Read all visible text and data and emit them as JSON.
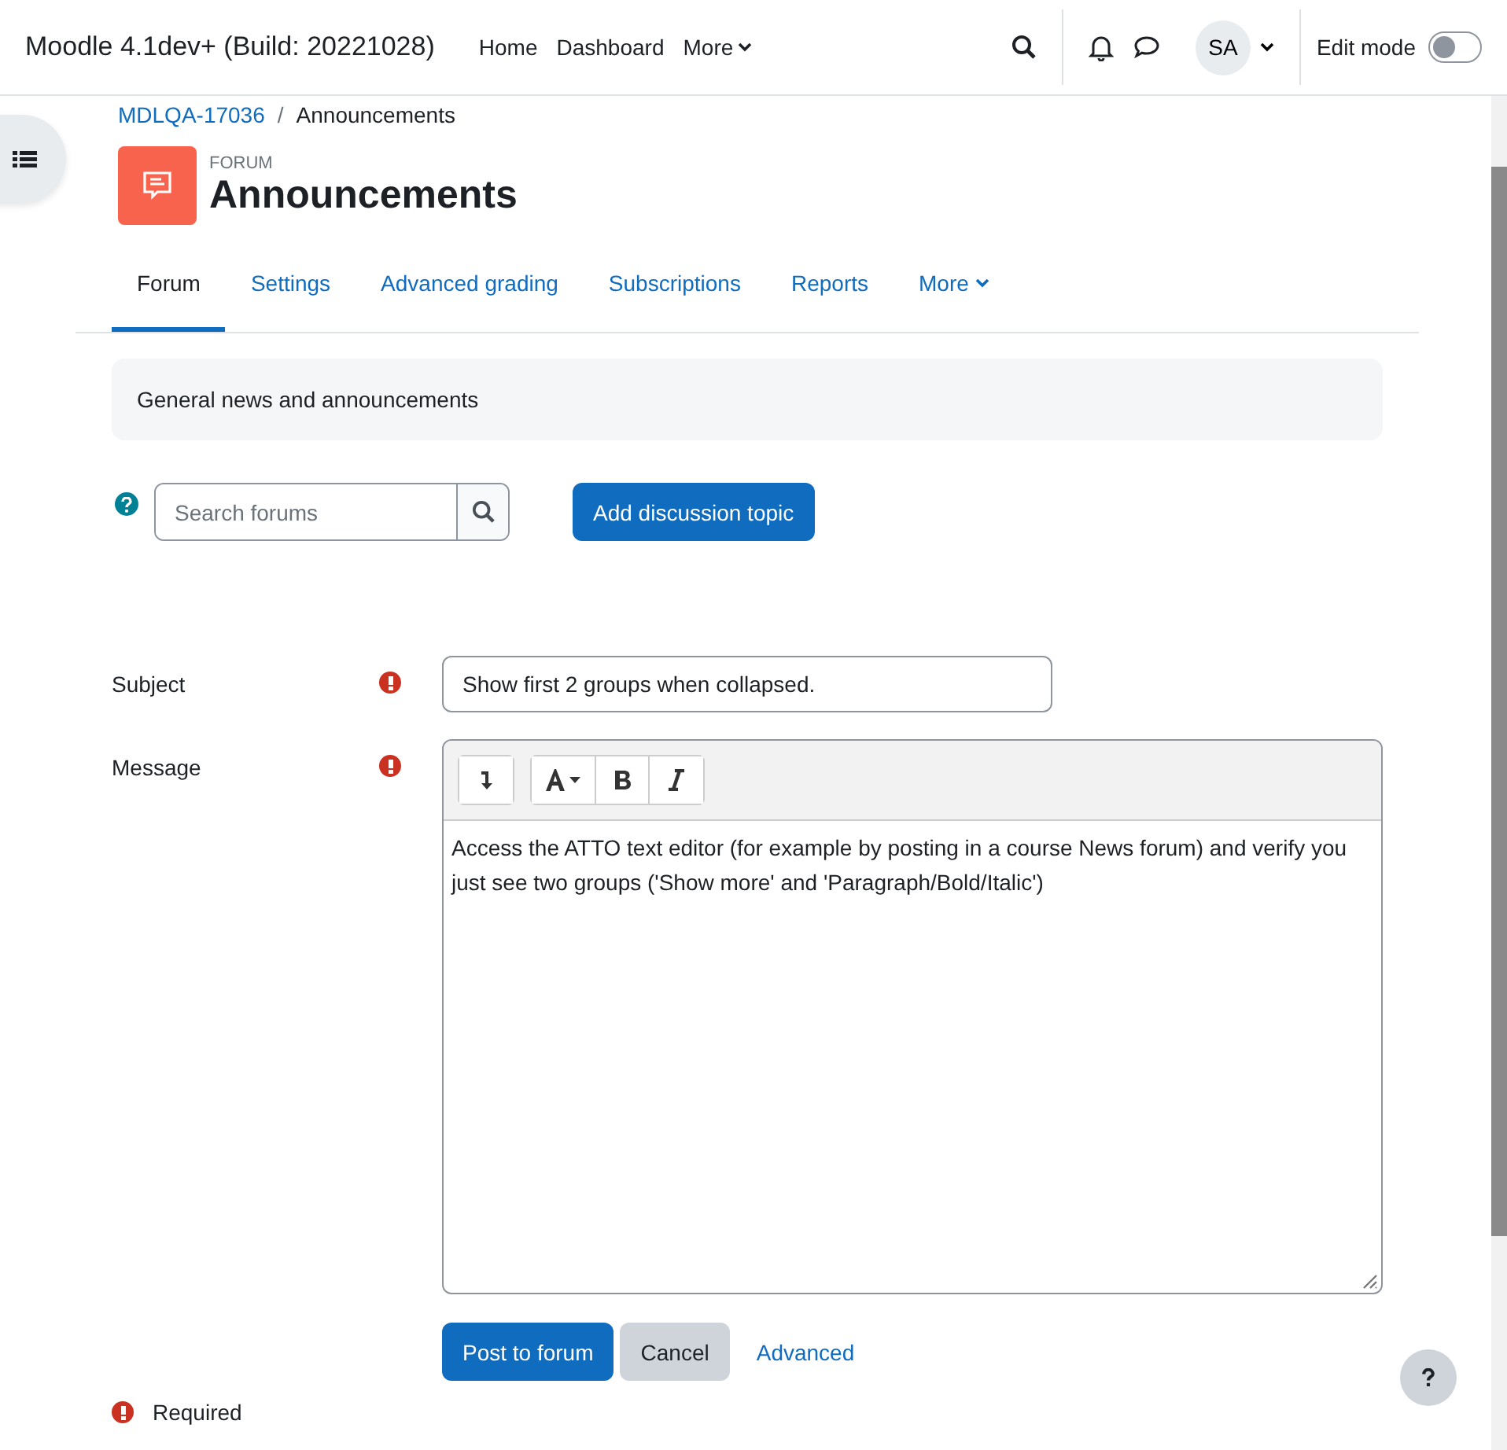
{
  "navbar": {
    "site_name": "Moodle 4.1dev+ (Build: 20221028)",
    "links": [
      {
        "label": "Home",
        "dropdown": false
      },
      {
        "label": "Dashboard",
        "dropdown": false
      },
      {
        "label": "More",
        "dropdown": true
      }
    ],
    "avatar": "SA",
    "edit_mode": {
      "label": "Edit mode",
      "on": false
    }
  },
  "breadcrumb": {
    "items": [
      "MDLQA-17036",
      "Announcements"
    ],
    "separator": "/"
  },
  "header": {
    "kind_label": "FORUM",
    "title": "Announcements"
  },
  "tabs": [
    {
      "label": "Forum",
      "selected": true,
      "dropdown": false
    },
    {
      "label": "Settings",
      "selected": false,
      "dropdown": false
    },
    {
      "label": "Advanced grading",
      "selected": false,
      "dropdown": false
    },
    {
      "label": "Subscriptions",
      "selected": false,
      "dropdown": false
    },
    {
      "label": "Reports",
      "selected": false,
      "dropdown": false
    },
    {
      "label": "More",
      "selected": false,
      "dropdown": true
    }
  ],
  "description": "General news and announcements",
  "search": {
    "placeholder": "Search forums"
  },
  "add_button": "Add discussion topic",
  "form": {
    "subject": {
      "label": "Subject",
      "required": true,
      "value": "Show first 2 groups when collapsed."
    },
    "message": {
      "label": "Message",
      "required": true,
      "value": "Access the ATTO text editor (for example by posting in a course News forum) and verify you just see two groups ('Show more' and 'Paragraph/Bold/Italic')"
    }
  },
  "buttons": {
    "post": "Post to forum",
    "cancel": "Cancel",
    "advanced": "Advanced"
  },
  "required_note": "Required"
}
